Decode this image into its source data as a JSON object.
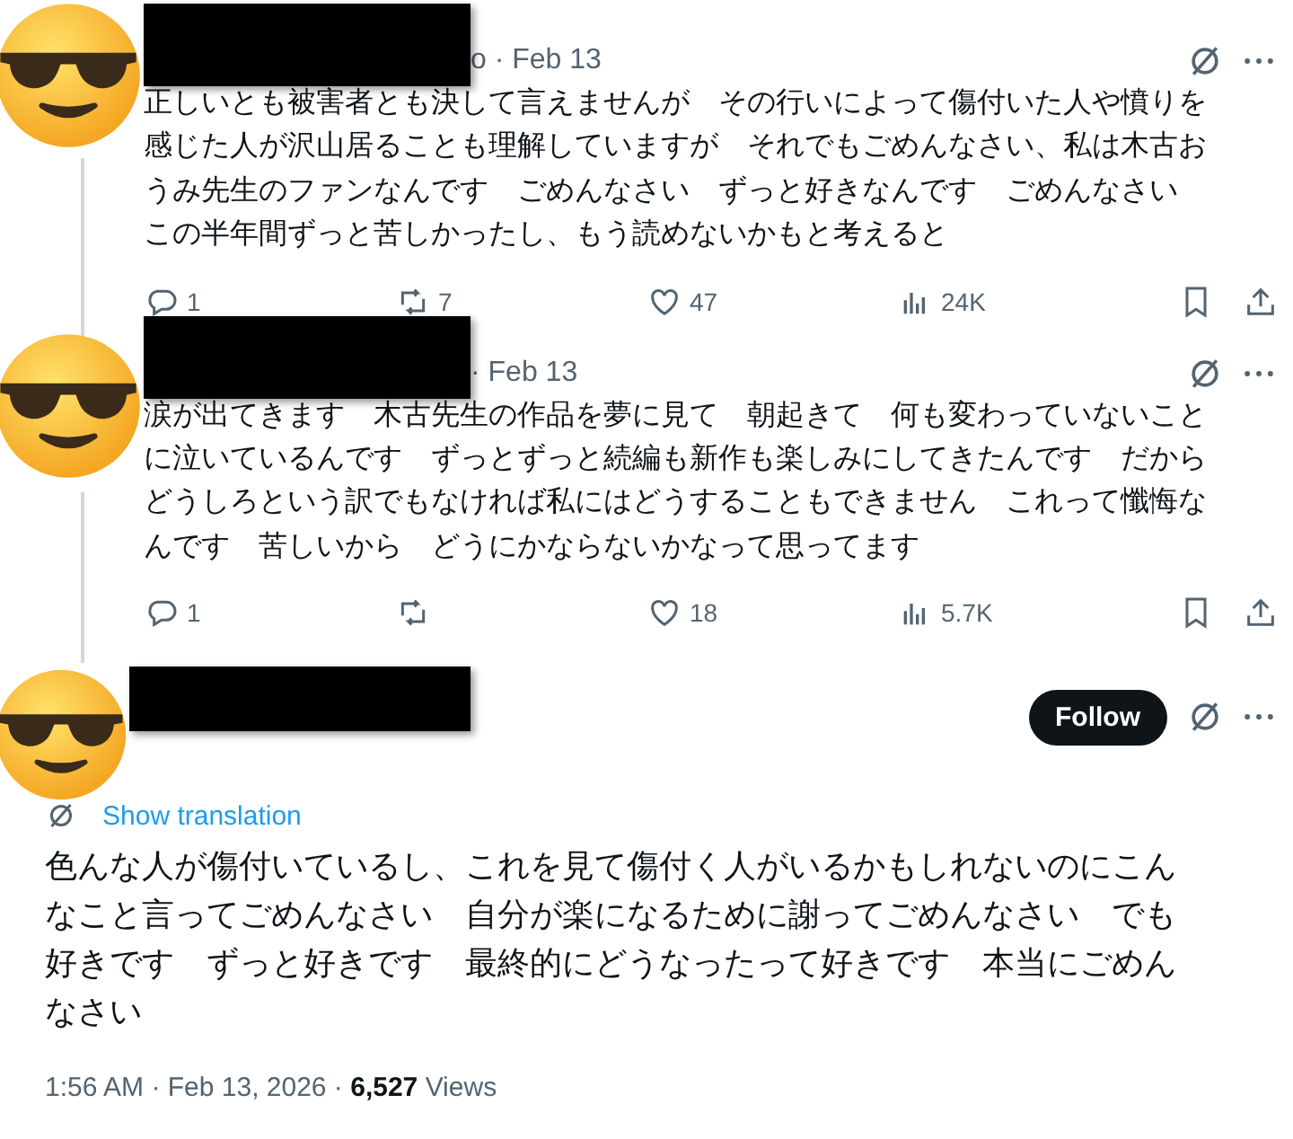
{
  "replies": [
    {
      "header_tail": "o · Feb 13",
      "lines": [
        "正しいとも被害者とも決して言えませんが　その行いによって傷付いた人や憤りを",
        "感じた人が沢山居ることも理解していますが　それでもごめんなさい、私は木古お",
        "うみ先生のファンなんです　ごめんなさい　ずっと好きなんです　ごめんなさい",
        "この半年間ずっと苦しかったし、もう読めないかもと考えると"
      ],
      "replies": "1",
      "reposts": "7",
      "likes": "47",
      "views": "24K"
    },
    {
      "header_tail": "· Feb 13",
      "lines": [
        "涙が出てきます　木古先生の作品を夢に見て　朝起きて　何も変わっていないこと",
        "に泣いているんです　ずっとずっと続編も新作も楽しみにしてきたんです　だから",
        "どうしろという訳でもなければ私にはどうすることもできません　これって懺悔な",
        "んです　苦しいから　どうにかならないかなって思ってます"
      ],
      "replies": "1",
      "likes": "18",
      "views": "5.7K"
    }
  ],
  "main_tweet": {
    "follow": "Follow",
    "translation": "Show translation",
    "lines": [
      "色んな人が傷付いているし、これを見て傷付く人がいるかもしれないのにこん",
      "なこと言ってごめんなさい　自分が楽になるために謝ってごめんなさい　でも",
      "好きです　ずっと好きです　最終的にどうなったって好きです　本当にごめん",
      "なさい"
    ],
    "meta": "1:56 AM · Feb 13, 2026 · **6,527** Views"
  }
}
